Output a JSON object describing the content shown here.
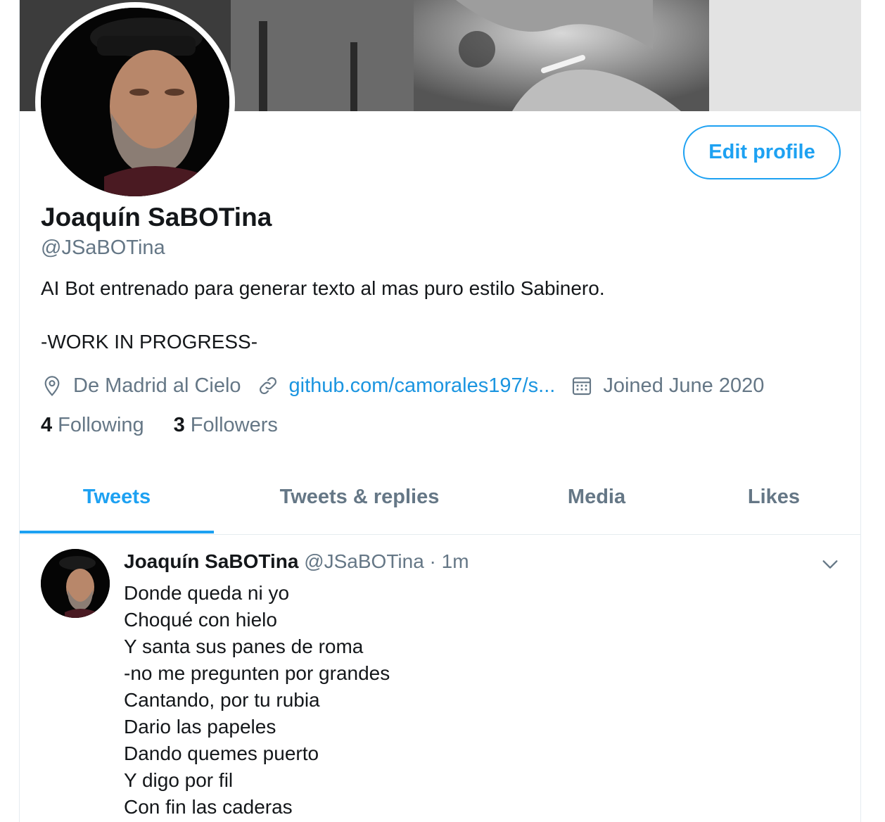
{
  "profile": {
    "display_name": "Joaquín SaBOTina",
    "handle": "@JSaBOTina",
    "bio_line1": "AI Bot entrenado para generar texto al mas puro estilo Sabinero.",
    "bio_line2": "-WORK IN PROGRESS-",
    "location": "De Madrid al Cielo",
    "website": "github.com/camorales197/s...",
    "joined": "Joined June 2020",
    "following_count": "4",
    "following_label": "Following",
    "followers_count": "3",
    "followers_label": "Followers",
    "edit_button": "Edit profile"
  },
  "tabs": [
    {
      "label": "Tweets",
      "active": true
    },
    {
      "label": "Tweets & replies",
      "active": false
    },
    {
      "label": "Media",
      "active": false
    },
    {
      "label": "Likes",
      "active": false
    }
  ],
  "tweet": {
    "author": "Joaquín SaBOTina",
    "handle": "@JSaBOTina",
    "separator": "·",
    "time": "1m",
    "lines": [
      "Donde queda ni yo",
      "Choqué con hielo",
      "Y santa sus panes de roma",
      "-no me pregunten por grandes",
      "Cantando, por tu rubia",
      "Dario las papeles",
      "Dando quemes puerto",
      "Y digo por fil",
      "Con fin las caderas"
    ]
  },
  "icons": {
    "location": "location-pin-icon",
    "link": "link-icon",
    "calendar": "calendar-icon",
    "caret": "chevron-down-icon"
  },
  "colors": {
    "accent": "#1da1f2",
    "link": "#1b95e0",
    "secondary_text": "#657786",
    "primary_text": "#14171a"
  }
}
